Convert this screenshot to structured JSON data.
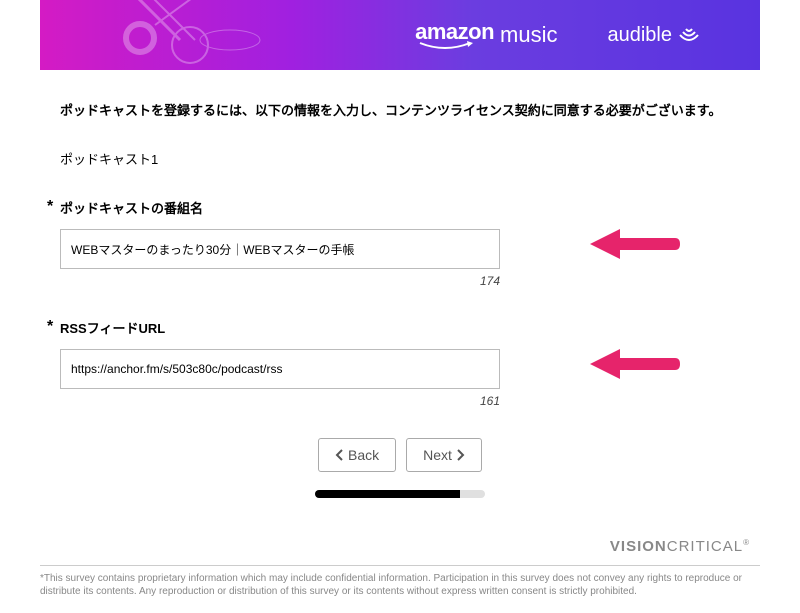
{
  "banner": {
    "brand1": "amazon",
    "brand1_sub": "music",
    "brand2": "audible"
  },
  "intro_text": "ポッドキャストを登録するには、以下の情報を入力し、コンテンツライセンス契約に同意する必要がございます。",
  "section_label": "ポッドキャスト1",
  "fields": {
    "podcast_name": {
      "label": "ポッドキャストの番組名",
      "value": "WEBマスターのまったり30分｜WEBマスターの手帳",
      "counter": "174"
    },
    "rss_url": {
      "label": "RSSフィードURL",
      "value": "https://anchor.fm/s/503c80c/podcast/rss",
      "counter": "161"
    }
  },
  "buttons": {
    "back": "Back",
    "next": "Next"
  },
  "footer_logo_bold": "VISION",
  "footer_logo_rest": "CRITICAL",
  "disclaimer": "*This survey contains proprietary information which may include confidential information. Participation in this survey does not convey any rights to reproduce or distribute its contents. Any reproduction or distribution of this survey or its contents without express written consent is strictly prohibited."
}
